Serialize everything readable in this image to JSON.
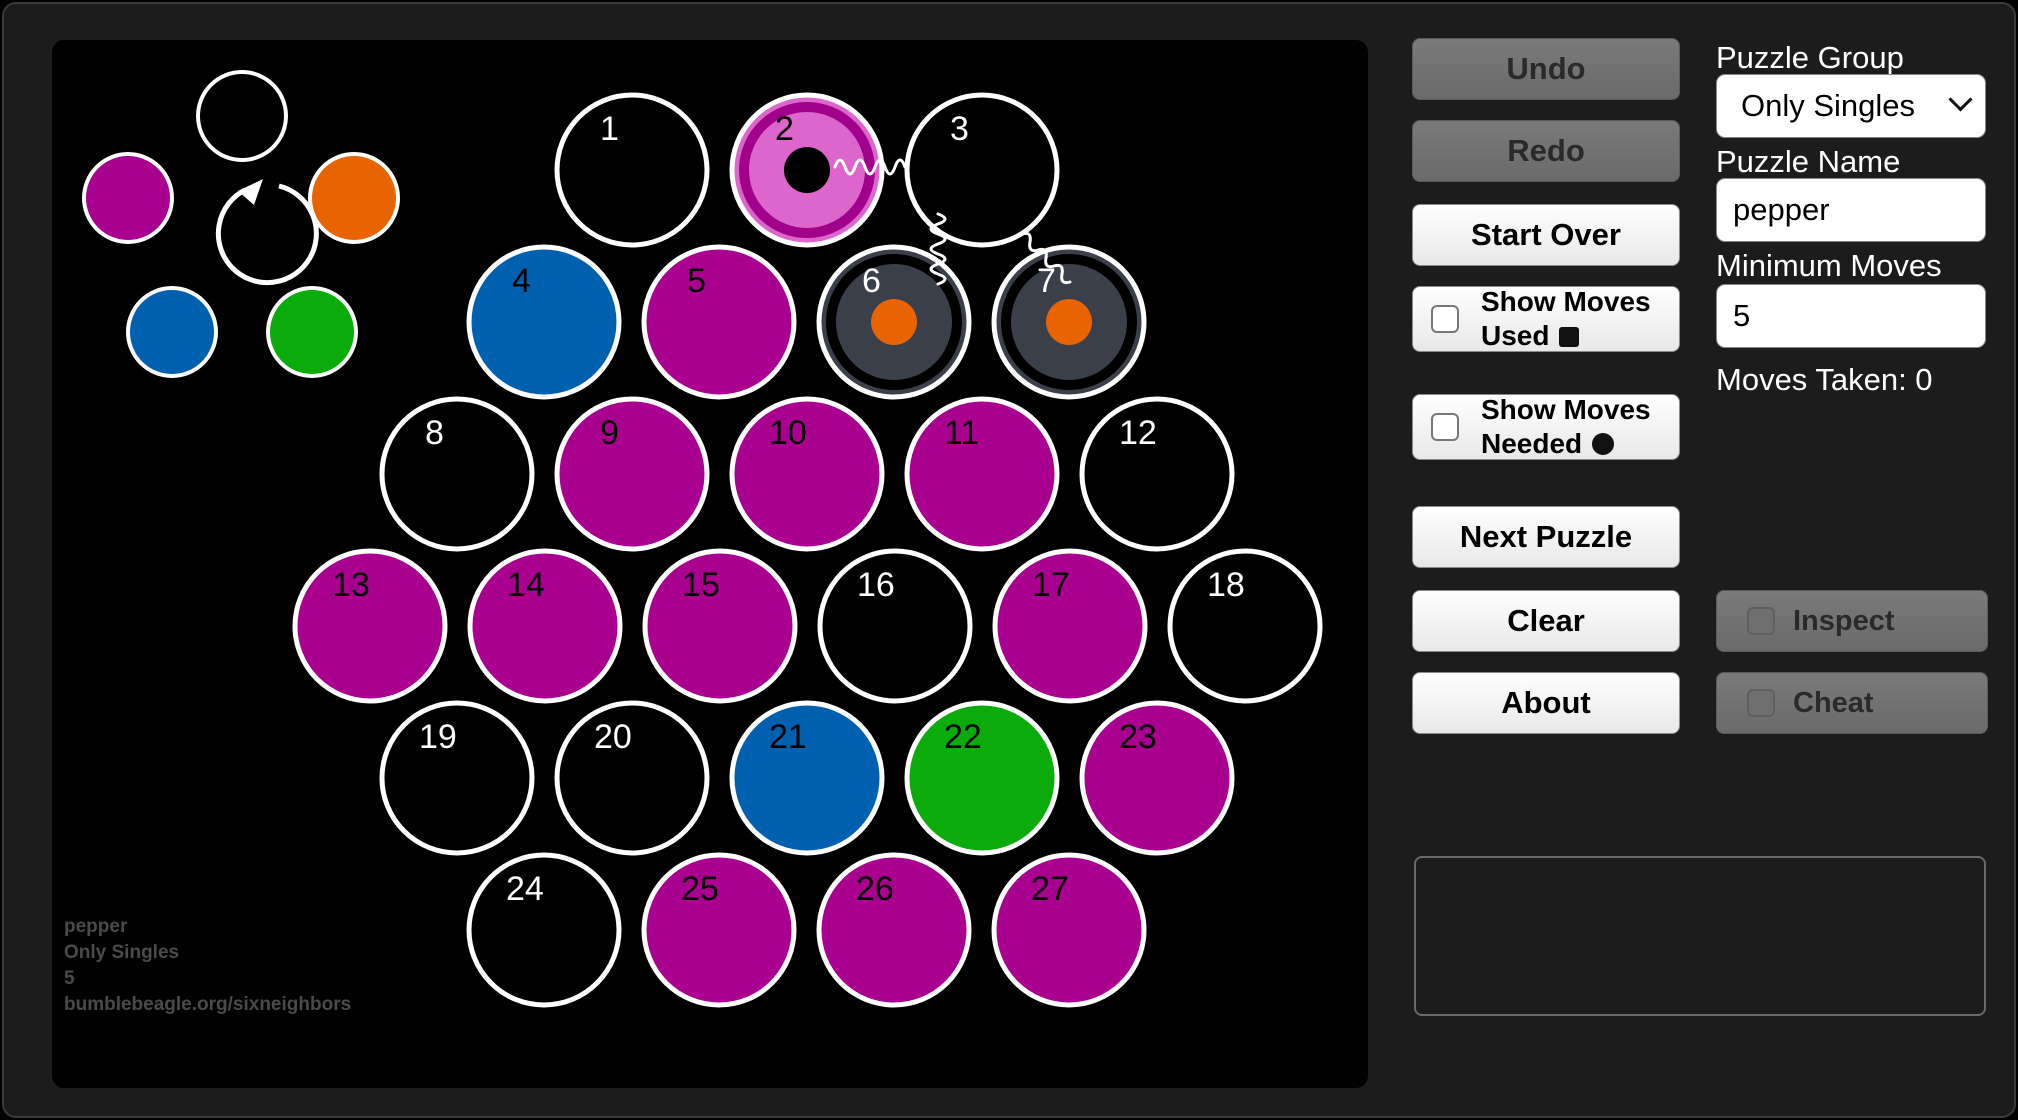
{
  "board": {
    "cells": [
      {
        "n": 1,
        "fill": "#000000"
      },
      {
        "n": 2,
        "fill": "#dd66cc",
        "ring": "#a0008a",
        "dot": "#000000"
      },
      {
        "n": 3,
        "fill": "#000000"
      },
      {
        "n": 4,
        "fill": "#0060b0"
      },
      {
        "n": 5,
        "fill": "#aa008f"
      },
      {
        "n": 6,
        "fill": "#3a3f4a",
        "ring": "#000000",
        "dot": "#e86400"
      },
      {
        "n": 7,
        "fill": "#3a3f4a",
        "ring": "#000000",
        "dot": "#e86400"
      },
      {
        "n": 8,
        "fill": "#000000"
      },
      {
        "n": 9,
        "fill": "#aa008f"
      },
      {
        "n": 10,
        "fill": "#aa008f"
      },
      {
        "n": 11,
        "fill": "#aa008f"
      },
      {
        "n": 12,
        "fill": "#000000"
      },
      {
        "n": 13,
        "fill": "#aa008f"
      },
      {
        "n": 14,
        "fill": "#aa008f"
      },
      {
        "n": 15,
        "fill": "#aa008f"
      },
      {
        "n": 16,
        "fill": "#000000"
      },
      {
        "n": 17,
        "fill": "#aa008f"
      },
      {
        "n": 18,
        "fill": "#000000"
      },
      {
        "n": 19,
        "fill": "#000000"
      },
      {
        "n": 20,
        "fill": "#000000"
      },
      {
        "n": 21,
        "fill": "#0060b0"
      },
      {
        "n": 22,
        "fill": "#0aab0a"
      },
      {
        "n": 23,
        "fill": "#aa008f"
      },
      {
        "n": 24,
        "fill": "#000000"
      },
      {
        "n": 25,
        "fill": "#aa008f"
      },
      {
        "n": 26,
        "fill": "#aa008f"
      },
      {
        "n": 27,
        "fill": "#aa008f"
      }
    ],
    "palette": [
      "#000000",
      "#e86400",
      "#0aab0a",
      "#0060b0",
      "#aa008f"
    ],
    "info": {
      "name": "pepper",
      "group": "Only Singles",
      "min_moves": "5",
      "site": "bumblebeagle.org/sixneighbors"
    }
  },
  "controls": {
    "undo": "Undo",
    "redo": "Redo",
    "start_over": "Start Over",
    "show_used_line1": "Show Moves",
    "show_used_line2": "Used",
    "show_needed_line1": "Show Moves",
    "show_needed_line2": "Needed",
    "next_puzzle": "Next Puzzle",
    "clear": "Clear",
    "about": "About",
    "inspect": "Inspect",
    "cheat": "Cheat"
  },
  "puzzle": {
    "group_label": "Puzzle Group",
    "group_value": "Only Singles",
    "name_label": "Puzzle Name",
    "name_value": "pepper",
    "min_label": "Minimum Moves",
    "min_value": "5",
    "taken_text": "Moves Taken: 0"
  }
}
